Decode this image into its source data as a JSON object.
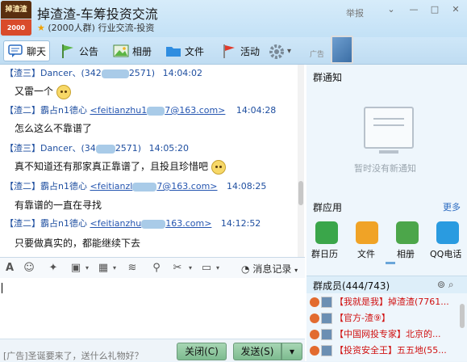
{
  "header": {
    "logo_top": "掉渣渣",
    "logo_bottom": "2000",
    "title": "掉渣渣-车筹投资交流",
    "subtitle": "(2000人群) 行业交流-投资",
    "report": "举报"
  },
  "toolbar": {
    "chat": "聊天",
    "notice": "公告",
    "album": "相册",
    "files": "文件",
    "activity": "活动"
  },
  "ad": {
    "label": "广告"
  },
  "messages": [
    {
      "tag": "【渣三】",
      "nick": "Dancer、(342",
      "email": "",
      "email_tail": "2571)",
      "time": "14:04:02",
      "body": "又雷一个"
    },
    {
      "tag": "【渣二】",
      "nick": "霸占n1德心",
      "email": "<feitianzhu1",
      "email_tail": "7@163.com>",
      "time": "14:04:28",
      "body": "怎么这么不靠谱了"
    },
    {
      "tag": "【渣三】",
      "nick": "Dancer、(34",
      "email": "",
      "email_tail": "2571)",
      "time": "14:05:20",
      "body": "真不知道还有那家真正靠谱了，且投且珍惜吧"
    },
    {
      "tag": "【渣二】",
      "nick": "霸占n1德心",
      "email": "<feitianzl",
      "email_tail": "7@163.com>",
      "time": "14:08:25",
      "body": "有靠谱的一直在寻找"
    },
    {
      "tag": "【渣二】",
      "nick": "霸占n1德心",
      "email": "<feitianzhu",
      "email_tail": "163.com>",
      "time": "14:12:52",
      "body": "只要做真实的，都能继续下去"
    }
  ],
  "input": {
    "history": "消息记录"
  },
  "bottom": {
    "ad_text": "[广告]圣诞要来了，送什么礼物好？",
    "close_label": "关闭(C)",
    "send_label": "发送(S)"
  },
  "right": {
    "notice_title": "群通知",
    "notice_empty": "暂时没有新通知",
    "apps_title": "群应用",
    "more": "更多",
    "apps": [
      {
        "label": "群日历",
        "color": "#3aa64a"
      },
      {
        "label": "文件",
        "color": "#f0a326"
      },
      {
        "label": "相册",
        "color": "#4ca64a"
      },
      {
        "label": "QQ电话",
        "color": "#2a9be0"
      }
    ],
    "members_title": "群成员(444/743)",
    "members": [
      {
        "label": "【我就是我】掉渣渣(7761..."
      },
      {
        "label": "【官方-渣⑨】"
      },
      {
        "label": "【中国网投专家】北京的..."
      },
      {
        "label": "【投资安全王】五五地(55..."
      }
    ]
  }
}
